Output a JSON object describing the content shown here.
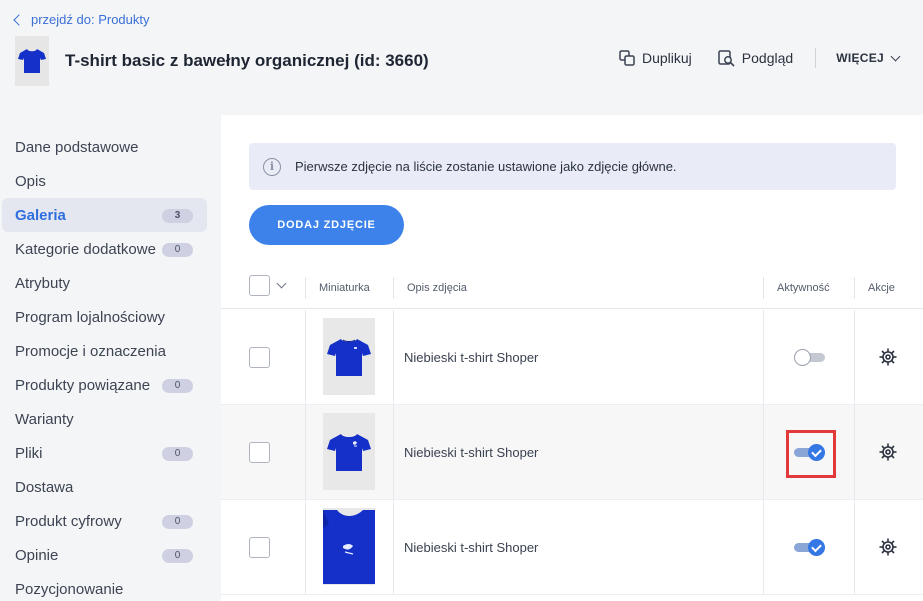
{
  "header": {
    "back_label": "przejdź do: Produkty",
    "product_title": "T-shirt basic z bawełny organicznej (id: 3660)",
    "actions": {
      "duplicate": "Duplikuj",
      "preview": "Podgląd",
      "more": "WIĘCEJ"
    }
  },
  "sidebar": {
    "items": [
      {
        "label": "Dane podstawowe"
      },
      {
        "label": "Opis"
      },
      {
        "label": "Galeria",
        "badge": "3"
      },
      {
        "label": "Kategorie dodatkowe",
        "badge": "0"
      },
      {
        "label": "Atrybuty"
      },
      {
        "label": "Program lojalnościowy"
      },
      {
        "label": "Promocje i oznaczenia"
      },
      {
        "label": "Produkty powiązane",
        "badge": "0"
      },
      {
        "label": "Warianty"
      },
      {
        "label": "Pliki",
        "badge": "0"
      },
      {
        "label": "Dostawa"
      },
      {
        "label": "Produkt cyfrowy",
        "badge": "0"
      },
      {
        "label": "Opinie",
        "badge": "0"
      },
      {
        "label": "Pozycjonowanie"
      }
    ],
    "active_index": 2
  },
  "gallery": {
    "info_text": "Pierwsze zdjęcie na liście zostanie ustawione jako zdjęcie główne.",
    "add_button": "DODAJ ZDJĘCIE",
    "columns": {
      "thumbnail": "Miniaturka",
      "description": "Opis zdjęcia",
      "active": "Aktywność",
      "actions": "Akcje"
    },
    "rows": [
      {
        "description": "Niebieski t-shirt Shoper",
        "active": false
      },
      {
        "description": "Niebieski t-shirt Shoper",
        "active": true
      },
      {
        "description": "Niebieski t-shirt Shoper",
        "active": true
      }
    ]
  },
  "colors": {
    "accent": "#3c82ea",
    "highlight": "#e23a3a",
    "shirt": "#1530c8"
  }
}
